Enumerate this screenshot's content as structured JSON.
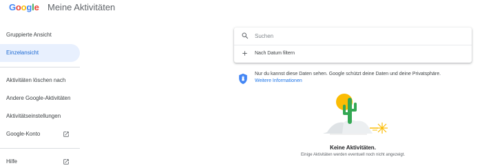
{
  "header": {
    "logo_letters": [
      {
        "char": "G",
        "color": "#4285f4"
      },
      {
        "char": "o",
        "color": "#ea4335"
      },
      {
        "char": "o",
        "color": "#fbbc05"
      },
      {
        "char": "g",
        "color": "#4285f4"
      },
      {
        "char": "l",
        "color": "#34a853"
      },
      {
        "char": "e",
        "color": "#ea4335"
      }
    ],
    "product_name": "Meine Aktivitäten"
  },
  "sidebar": {
    "items": [
      {
        "label": "Gruppierte Ansicht",
        "active": false
      },
      {
        "label": "Einzelansicht",
        "active": true
      },
      {
        "label": "Aktivitäten löschen nach",
        "active": false
      },
      {
        "label": "Andere Google-Aktivitäten",
        "active": false
      },
      {
        "label": "Aktivitätseinstellungen",
        "active": false
      },
      {
        "label": "Google-Konto",
        "active": false,
        "icon": "open-in-new-icon"
      },
      {
        "label": "Hilfe",
        "active": false,
        "icon": "open-in-new-icon"
      }
    ],
    "active_color": "#e8f0fe",
    "active_text_color": "#1967d2"
  },
  "search": {
    "placeholder": "Suchen",
    "value": "",
    "icon": "search-icon",
    "filter_label": "Nach Datum filtern",
    "filter_icon": "plus-icon"
  },
  "privacy": {
    "icon": "shield-icon",
    "text": "Nur du kannst diese Daten sehen. Google schützt deine Daten und deine Privatsphäre.",
    "link": "Weitere Informationen",
    "link_color": "#1a73e8"
  },
  "empty_state": {
    "illustration": "desert-cactus-illustration",
    "title": "Keine Aktivitäten.",
    "subtitle": "Einige Aktivitäten werden eventuell noch nicht angezeigt."
  }
}
